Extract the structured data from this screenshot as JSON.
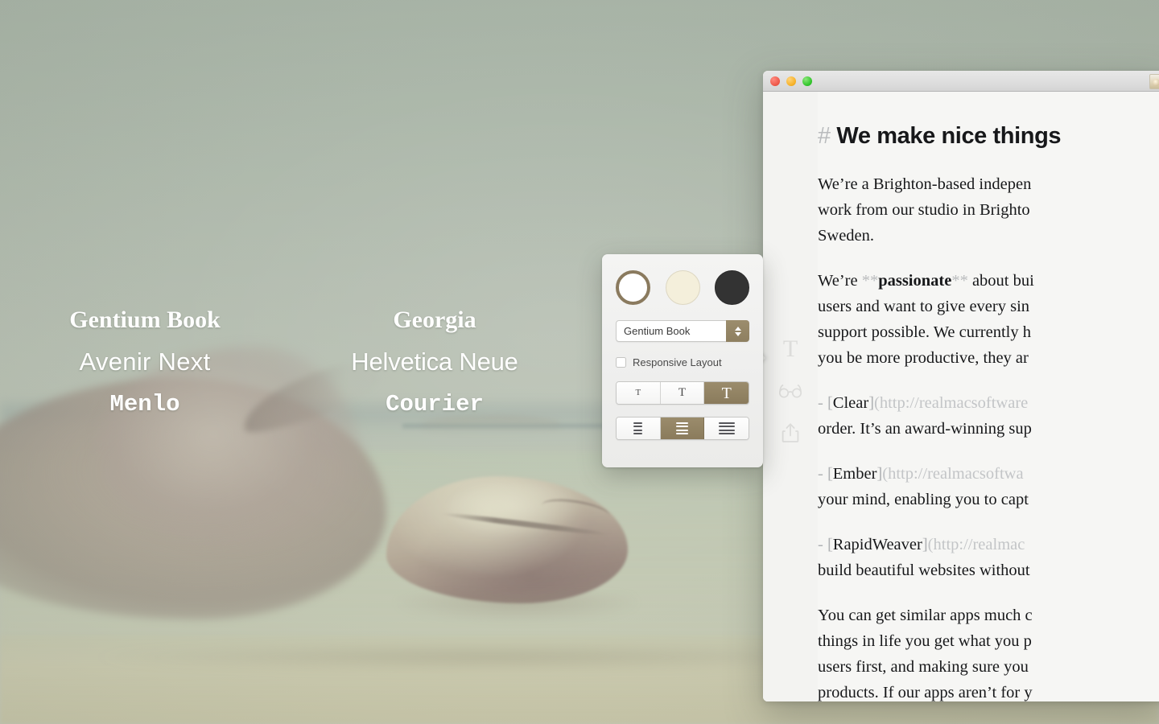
{
  "desktop": {
    "wallpaper_description": "faded beach photo with granite boulders in shallow water",
    "font_samples": [
      {
        "name": "Gentium Book",
        "style": "serif-bold"
      },
      {
        "name": "Georgia",
        "style": "serif-bold"
      },
      {
        "name": "Avenir Next",
        "style": "sans"
      },
      {
        "name": "Helvetica Neue",
        "style": "sans"
      },
      {
        "name": "Menlo",
        "style": "mono"
      },
      {
        "name": "Courier",
        "style": "mono"
      }
    ]
  },
  "window": {
    "traffic_lights": [
      {
        "name": "close",
        "color": "#ef5b4c"
      },
      {
        "name": "minimize",
        "color": "#f7b32b"
      },
      {
        "name": "zoom",
        "color": "#35c62e"
      }
    ],
    "rail_items": [
      {
        "icon": "typography-icon",
        "glyph": "T"
      },
      {
        "icon": "glasses-icon",
        "glyph": ""
      },
      {
        "icon": "share-icon",
        "glyph": ""
      }
    ]
  },
  "document": {
    "heading": {
      "hash": "#",
      "text": "We make nice things"
    },
    "paragraphs": [
      {
        "id": "intro",
        "runs": [
          {
            "type": "text",
            "text": "We’re a Brighton-based indepen"
          }
        ],
        "lines": [
          "We’re a Brighton-based indepen",
          "work from our studio in Brighto",
          "Sweden."
        ]
      },
      {
        "id": "passionate",
        "lines": [
          "We’re **passionate** about bui",
          "users and want to give every sin",
          "support possible. We currently h",
          "you be more productive, they ar"
        ],
        "bold_word": "passionate",
        "marks": "**"
      },
      {
        "id": "clear",
        "bullet": "-",
        "link_text": "Clear",
        "link_url": "(http://realmacsoftware",
        "lines": [
          "- [Clear](http://realmacsoftware",
          "order. It’s an award-winning sup"
        ]
      },
      {
        "id": "ember",
        "bullet": "-",
        "link_text": "Ember",
        "link_url": "(http://realmacsoftwa",
        "lines": [
          "- [Ember](http://realmacsoftwa",
          "your mind, enabling you to capt"
        ]
      },
      {
        "id": "rapidweaver",
        "bullet": "-",
        "link_text": "RapidWeaver",
        "link_url": "(http://realmac",
        "lines": [
          "- [RapidWeaver](http://realmac",
          "build beautiful websites without"
        ]
      },
      {
        "id": "closing",
        "lines": [
          "You can get similar apps much c",
          "things in life you get what you p",
          "users first, and making sure you",
          "products. If our apps aren’t for y"
        ]
      }
    ]
  },
  "typography_popover": {
    "theme_swatches": [
      {
        "name": "white",
        "color": "#ffffff",
        "selected": true
      },
      {
        "name": "sepia",
        "color": "#f4efdb",
        "selected": false
      },
      {
        "name": "dark",
        "color": "#333333",
        "selected": false
      }
    ],
    "font_select": {
      "value": "Gentium Book",
      "placeholder": "Gentium Book"
    },
    "responsive_layout": {
      "label": "Responsive Layout",
      "checked": false
    },
    "text_size": {
      "options": [
        "T",
        "T",
        "T"
      ],
      "selected_index": 2
    },
    "line_width": {
      "options": [
        "narrow",
        "medium",
        "wide"
      ],
      "selected_index": 1
    },
    "accent_color": "#8a7b5c"
  }
}
